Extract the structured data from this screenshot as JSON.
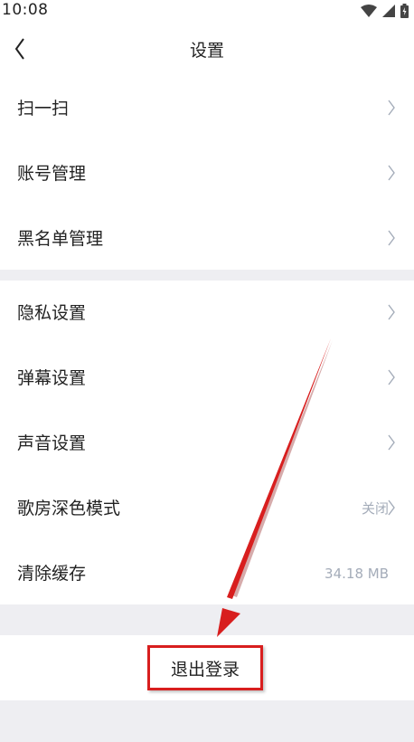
{
  "status_bar": {
    "time": "10:08",
    "icons": [
      "wifi-icon",
      "signal-icon",
      "battery-icon"
    ]
  },
  "header": {
    "back_icon": "chevron-left-icon",
    "title": "设置"
  },
  "group1": [
    {
      "label": "扫一扫"
    },
    {
      "label": "账号管理"
    },
    {
      "label": "黑名单管理"
    }
  ],
  "group2": [
    {
      "label": "隐私设置"
    },
    {
      "label": "弹幕设置"
    },
    {
      "label": "声音设置"
    },
    {
      "label": "歌房深色模式",
      "value": "关闭"
    },
    {
      "label": "清除缓存",
      "value": "34.18 MB"
    }
  ],
  "logout": {
    "label": "退出登录"
  },
  "colors": {
    "background": "#eeeef2",
    "annotation_red": "#d81e1e",
    "secondary_text": "#a4acb9"
  }
}
